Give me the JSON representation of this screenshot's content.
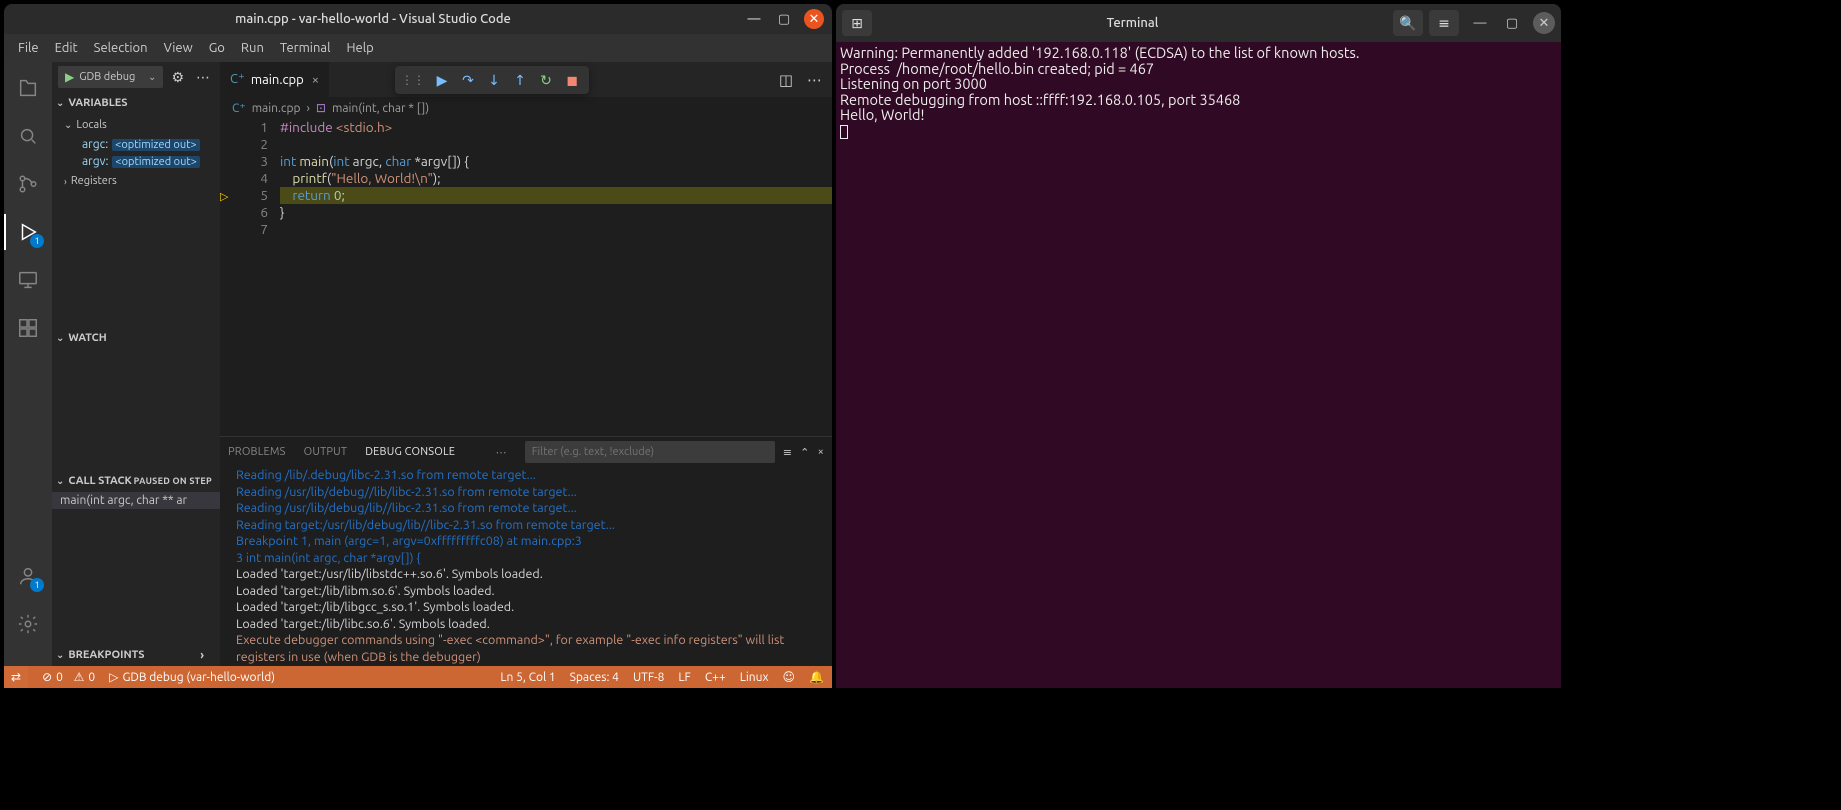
{
  "vscode": {
    "titlebar": "main.cpp - var-hello-world - Visual Studio Code",
    "menu": [
      "File",
      "Edit",
      "Selection",
      "View",
      "Go",
      "Run",
      "Terminal",
      "Help"
    ],
    "run_config": "GDB debug",
    "sidebar": {
      "variables_label": "VARIABLES",
      "locals_label": "Locals",
      "vars": [
        {
          "name": "argc:",
          "val": "<optimized out>"
        },
        {
          "name": "argv:",
          "val": "<optimized out>"
        }
      ],
      "registers_label": "Registers",
      "watch_label": "WATCH",
      "callstack_label": "CALL STACK",
      "callstack_status": "PAUSED ON STEP",
      "callstack_row": "main(int argc, char ** ar",
      "breakpoints_label": "BREAKPOINTS"
    },
    "tab": {
      "name": "main.cpp"
    },
    "crumbs": {
      "file": "main.cpp",
      "symbol": "main(int, char * [])"
    },
    "code": {
      "lines": [
        {
          "n": 1,
          "tokens": [
            [
              "inc",
              "#include "
            ],
            [
              "str",
              "<stdio.h>"
            ]
          ]
        },
        {
          "n": 2,
          "tokens": []
        },
        {
          "n": 3,
          "tokens": [
            [
              "typ",
              "int "
            ],
            [
              "fn",
              "main"
            ],
            [
              "",
              "("
            ],
            [
              "typ",
              "int "
            ],
            [
              "",
              "argc, "
            ],
            [
              "typ",
              "char "
            ],
            [
              "",
              "*argv[]) {"
            ]
          ]
        },
        {
          "n": 4,
          "tokens": [
            [
              "",
              "    "
            ],
            [
              "fn",
              "printf"
            ],
            [
              "",
              "("
            ],
            [
              "str",
              "\"Hello, World!\\n\""
            ],
            [
              "",
              ");"
            ]
          ]
        },
        {
          "n": 5,
          "hl": true,
          "bp": true,
          "tokens": [
            [
              "",
              "    "
            ],
            [
              "kw",
              "return "
            ],
            [
              "num",
              "0"
            ],
            [
              "",
              ";"
            ]
          ]
        },
        {
          "n": 6,
          "tokens": [
            [
              "",
              "}"
            ]
          ]
        },
        {
          "n": 7,
          "tokens": []
        }
      ]
    },
    "panel": {
      "tabs": [
        "PROBLEMS",
        "OUTPUT",
        "DEBUG CONSOLE"
      ],
      "active": 2,
      "filter_placeholder": "Filter (e.g. text, !exclude)",
      "lines": [
        {
          "cls": "pb-blue",
          "t": "Reading /lib/.debug/libc-2.31.so from remote target..."
        },
        {
          "cls": "pb-blue",
          "t": "Reading /usr/lib/debug//lib/libc-2.31.so from remote target..."
        },
        {
          "cls": "pb-blue",
          "t": "Reading /usr/lib/debug/lib//libc-2.31.so from remote target..."
        },
        {
          "cls": "pb-blue",
          "t": "Reading target:/usr/lib/debug/lib//libc-2.31.so from remote target..."
        },
        {
          "cls": "pb-blue",
          "t": " "
        },
        {
          "cls": "pb-blue",
          "t": "Breakpoint 1, main (argc=1, argv=0xfffffffffc08) at main.cpp:3"
        },
        {
          "cls": "pb-blue",
          "t": "3       int main(int argc, char *argv[]) {"
        },
        {
          "cls": "pb-default",
          "t": "Loaded 'target:/usr/lib/libstdc++.so.6'. Symbols loaded."
        },
        {
          "cls": "pb-default",
          "t": "Loaded 'target:/lib/libm.so.6'. Symbols loaded."
        },
        {
          "cls": "pb-default",
          "t": "Loaded 'target:/lib/libgcc_s.so.1'. Symbols loaded."
        },
        {
          "cls": "pb-default",
          "t": "Loaded 'target:/lib/libc.so.6'. Symbols loaded."
        },
        {
          "cls": "pb-yellow",
          "t": "Execute debugger commands using \"-exec <command>\", for example \"-exec info registers\" will list registers in use (when GDB is the debugger)"
        }
      ]
    },
    "status": {
      "errors": "0",
      "warnings": "0",
      "debug": "GDB debug (var-hello-world)",
      "pos": "Ln 5, Col 1",
      "spaces": "Spaces: 4",
      "enc": "UTF-8",
      "eol": "LF",
      "lang": "C++",
      "os": "Linux"
    }
  },
  "terminal": {
    "title": "Terminal",
    "lines": [
      "Warning: Permanently added '192.168.0.118' (ECDSA) to the list of known hosts.",
      "Process  /home/root/hello.bin created; pid = 467",
      "Listening on port 3000",
      "Remote debugging from host ::ffff:192.168.0.105, port 35468",
      "Hello, World!"
    ]
  }
}
